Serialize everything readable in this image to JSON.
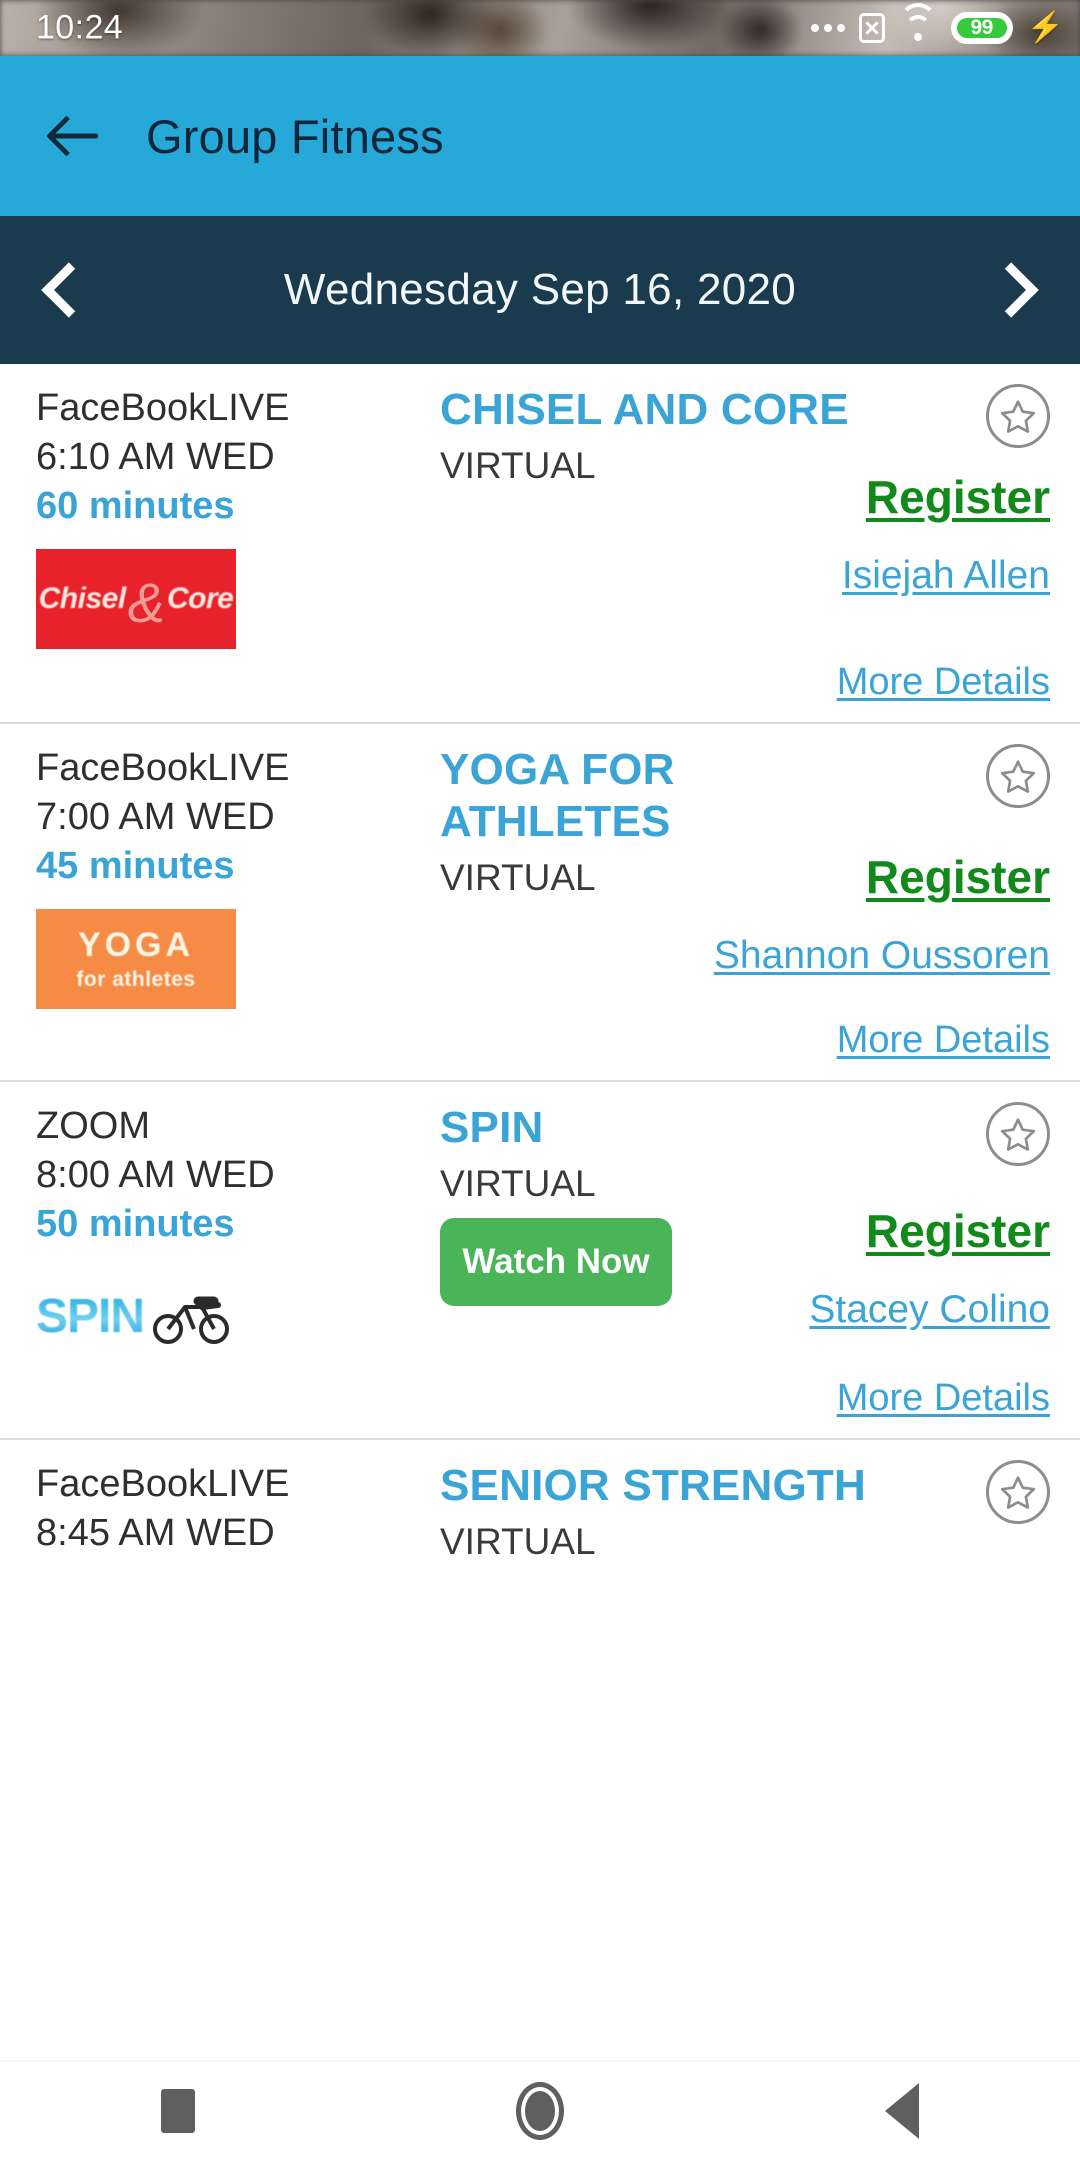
{
  "status_bar": {
    "time": "10:24",
    "icons": [
      "more-dots-icon",
      "x-box-icon",
      "wifi-icon",
      "battery-icon",
      "charging-bolt-icon"
    ],
    "battery_level": "99"
  },
  "app_bar": {
    "title": "Group Fitness",
    "back_icon": "back-arrow-icon",
    "background_color": "#26a9d8"
  },
  "date_bar": {
    "date": "Wednesday Sep 16, 2020",
    "prev_icon": "chevron-left-icon",
    "next_icon": "chevron-right-icon",
    "background_color": "#1a3a4e"
  },
  "classes": [
    {
      "modality": "FaceBookLIVE",
      "time": "6:10 AM WED",
      "duration": "60 minutes",
      "thumbnail": {
        "type": "chisel-core-logo",
        "text_a": "Chisel",
        "amp": "&",
        "text_b": "Core",
        "bg": "#e8222a"
      },
      "title": "CHISEL AND CORE",
      "location": "VIRTUAL",
      "watch_label": null,
      "register_label": "Register",
      "instructor": "Isiejah Allen",
      "more_details": "More Details",
      "favorite_icon": "star-outline-icon"
    },
    {
      "modality": "FaceBookLIVE",
      "time": "7:00 AM WED",
      "duration": "45 minutes",
      "thumbnail": {
        "type": "yoga-athletes-logo",
        "line1": "YOGA",
        "line2": "for athletes",
        "bg": "#f68b45"
      },
      "title": "YOGA FOR ATHLETES",
      "location": "VIRTUAL",
      "watch_label": null,
      "register_label": "Register",
      "instructor": "Shannon Oussoren",
      "more_details": "More Details",
      "favorite_icon": "star-outline-icon"
    },
    {
      "modality": "ZOOM",
      "time": "8:00 AM WED",
      "duration": "50 minutes",
      "thumbnail": {
        "type": "spin-logo",
        "line1": "SPIN",
        "icon": "cyclist-icon",
        "bg": "#ffffff"
      },
      "title": "SPIN",
      "location": "VIRTUAL",
      "watch_label": "Watch Now",
      "register_label": "Register",
      "instructor": "Stacey Colino",
      "more_details": "More Details",
      "favorite_icon": "star-outline-icon"
    },
    {
      "modality": "FaceBookLIVE",
      "time": "8:45 AM WED",
      "duration": null,
      "thumbnail": null,
      "title": "SENIOR STRENGTH",
      "location": "VIRTUAL",
      "watch_label": null,
      "register_label": null,
      "instructor": null,
      "more_details": null,
      "favorite_icon": "star-outline-icon"
    }
  ],
  "nav_bar": {
    "recents_icon": "square-recents-icon",
    "home_icon": "circle-home-icon",
    "back_icon": "triangle-back-icon"
  },
  "colors": {
    "accent_blue": "#3aa4d6",
    "header_blue": "#26a9d8",
    "date_navy": "#1a3a4e",
    "register_green": "#12891b",
    "watch_green": "#49b458"
  }
}
